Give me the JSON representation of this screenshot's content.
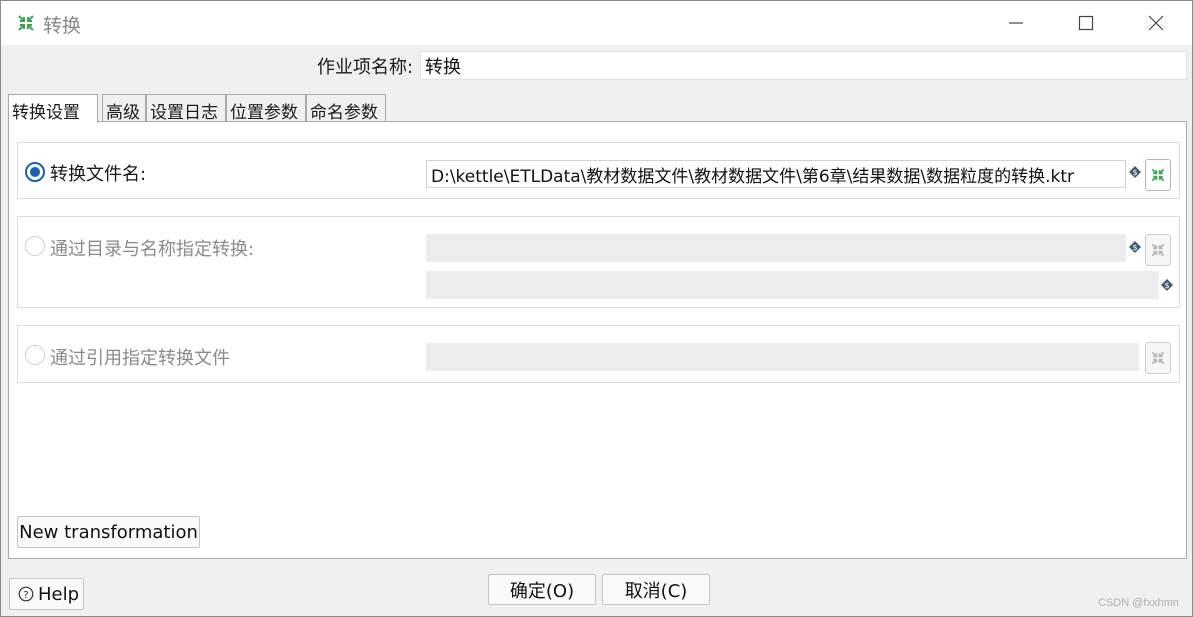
{
  "window": {
    "title": "转换",
    "accent_color": "#3aa655"
  },
  "job": {
    "name_label": "作业项名称:",
    "name_value": "转换"
  },
  "tabs": [
    {
      "label": "转换设置",
      "active": true
    },
    {
      "label": "高级",
      "active": false
    },
    {
      "label": "设置日志",
      "active": false
    },
    {
      "label": "位置参数",
      "active": false
    },
    {
      "label": "命名参数",
      "active": false
    }
  ],
  "options": {
    "by_file": {
      "label": "转换文件名:",
      "selected": true,
      "value": "D:\\kettle\\ETLData\\教材数据文件\\教材数据文件\\第6章\\结果数据\\数据粒度的转换.ktr"
    },
    "by_repo": {
      "label": "通过目录与名称指定转换:",
      "selected": false,
      "directory_value": "",
      "name_value": ""
    },
    "by_reference": {
      "label": "通过引用指定转换文件",
      "selected": false,
      "value": ""
    }
  },
  "buttons": {
    "new_transformation": "New transformation",
    "ok": "确定(O)",
    "cancel": "取消(C)",
    "help": "Help"
  },
  "watermark": "CSDN @fxxhmn"
}
